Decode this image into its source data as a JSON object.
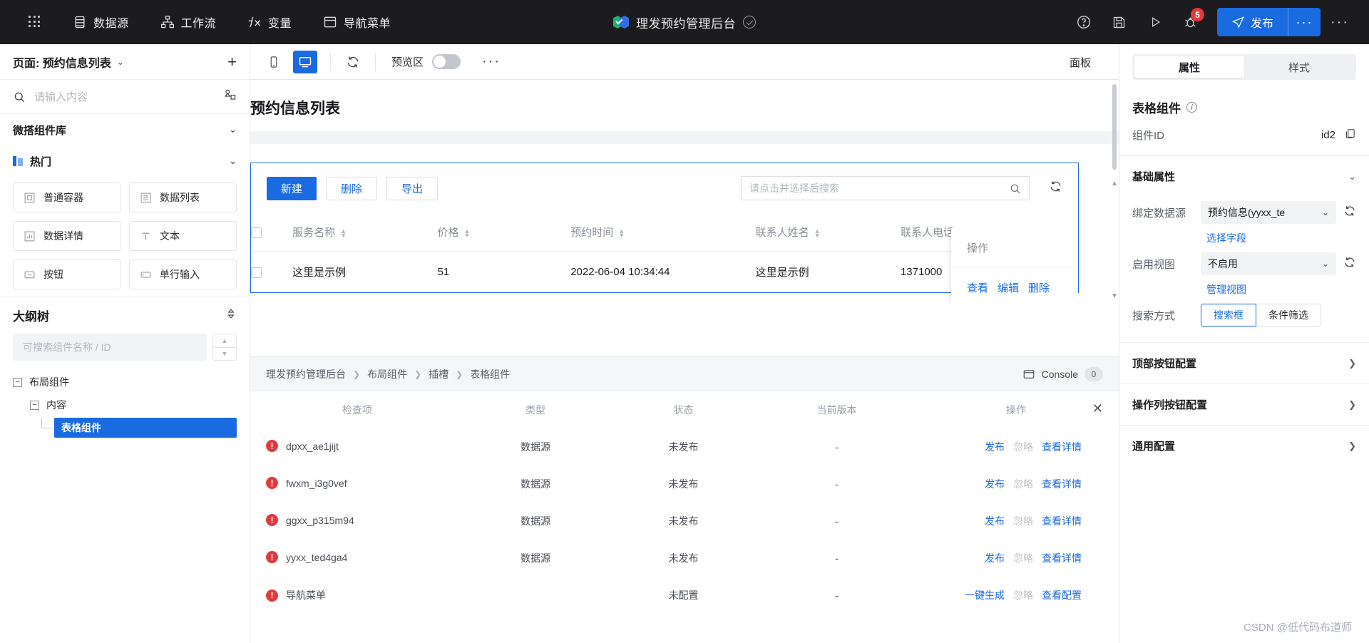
{
  "topbar": {
    "apps_icon": "grid-apps-icon",
    "nav": [
      {
        "label": "数据源",
        "icon": "database-icon"
      },
      {
        "label": "工作流",
        "icon": "workflow-icon"
      },
      {
        "label": "变量",
        "icon": "fx-icon"
      },
      {
        "label": "导航菜单",
        "icon": "window-menu-icon"
      }
    ],
    "app_title": "理发预约管理后台",
    "actions": {
      "help": "help-circle-icon",
      "save": "save-icon",
      "preview": "play-icon",
      "debug": "bug-icon",
      "debug_badge": "5",
      "publish_label": "发布",
      "publish_more": "···",
      "overflow": "···"
    }
  },
  "left": {
    "page_label": "页面: 预约信息列表",
    "add_page": "+",
    "search_placeholder": "请输入内容",
    "library_title": "微搭组件库",
    "group_title": "热门",
    "components": [
      {
        "label": "普通容器",
        "icon": "container-icon"
      },
      {
        "label": "数据列表",
        "icon": "list-icon"
      },
      {
        "label": "数据详情",
        "icon": "detail-chart-icon"
      },
      {
        "label": "文本",
        "icon": "text-icon"
      },
      {
        "label": "按钮",
        "icon": "button-icon"
      },
      {
        "label": "单行输入",
        "icon": "input-icon"
      }
    ],
    "outline_title": "大纲树",
    "outline_search_placeholder": "可搜索组件名称 / ID",
    "tree": [
      {
        "label": "布局组件",
        "level": 0
      },
      {
        "label": "内容",
        "level": 1
      },
      {
        "label": "表格组件",
        "level": 2,
        "selected": true
      }
    ]
  },
  "toolbar": {
    "mobile_icon": "phone-icon",
    "desktop_icon": "desktop-icon",
    "refresh_icon": "refresh-icon",
    "preview_label": "预览区",
    "preview_on": false,
    "more": "···",
    "panel_label": "面板"
  },
  "canvas": {
    "page_title": "预约信息列表",
    "buttons": [
      {
        "label": "新建",
        "type": "primary"
      },
      {
        "label": "删除",
        "type": "default"
      },
      {
        "label": "导出",
        "type": "default"
      }
    ],
    "search_placeholder": "请点击并选择后搜索",
    "search_icon": "search-icon",
    "refresh_icon": "refresh-icon",
    "table": {
      "columns": [
        {
          "label": "服务名称",
          "sortable": true
        },
        {
          "label": "价格",
          "sortable": true
        },
        {
          "label": "预约时间",
          "sortable": true
        },
        {
          "label": "联系人姓名",
          "sortable": true
        },
        {
          "label": "联系人电话",
          "sortable": true
        }
      ],
      "action_column": "操作",
      "rows": [
        {
          "服务名称": "这里是示例",
          "价格": "51",
          "预约时间": "2022-06-04 10:34:44",
          "联系人姓名": "这里是示例",
          "联系人电话": "1371000"
        }
      ],
      "row_actions": [
        "查看",
        "编辑",
        "删除"
      ]
    }
  },
  "console": {
    "breadcrumb": [
      "理发预约管理后台",
      "布局组件",
      "插槽",
      "表格组件"
    ],
    "tab_label": "Console",
    "tab_count": "0",
    "close_icon": "close-icon",
    "columns": [
      "检查项",
      "类型",
      "状态",
      "当前版本",
      "操作"
    ],
    "rows": [
      {
        "name": "dpxx_ae1jijt",
        "type": "数据源",
        "status": "未发布",
        "version": "-",
        "actions": [
          {
            "label": "发布",
            "enabled": true
          },
          {
            "label": "忽略",
            "enabled": false
          },
          {
            "label": "查看详情",
            "enabled": true
          }
        ]
      },
      {
        "name": "fwxm_i3g0vef",
        "type": "数据源",
        "status": "未发布",
        "version": "-",
        "actions": [
          {
            "label": "发布",
            "enabled": true
          },
          {
            "label": "忽略",
            "enabled": false
          },
          {
            "label": "查看详情",
            "enabled": true
          }
        ]
      },
      {
        "name": "ggxx_p315m94",
        "type": "数据源",
        "status": "未发布",
        "version": "-",
        "actions": [
          {
            "label": "发布",
            "enabled": true
          },
          {
            "label": "忽略",
            "enabled": false
          },
          {
            "label": "查看详情",
            "enabled": true
          }
        ]
      },
      {
        "name": "yyxx_ted4ga4",
        "type": "数据源",
        "status": "未发布",
        "version": "-",
        "actions": [
          {
            "label": "发布",
            "enabled": true
          },
          {
            "label": "忽略",
            "enabled": false
          },
          {
            "label": "查看详情",
            "enabled": true
          }
        ]
      },
      {
        "name": "导航菜单",
        "type": "",
        "status": "未配置",
        "version": "-",
        "actions": [
          {
            "label": "一键生成",
            "enabled": true
          },
          {
            "label": "忽略",
            "enabled": false
          },
          {
            "label": "查看配置",
            "enabled": true
          }
        ]
      }
    ],
    "watermark": "CSDN @低代码布道师"
  },
  "right": {
    "tabs": [
      {
        "label": "属性",
        "active": true
      },
      {
        "label": "样式",
        "active": false
      }
    ],
    "component_title": "表格组件",
    "component_id_label": "组件ID",
    "component_id_value": "id2",
    "copy_icon": "copy-icon",
    "base_section": "基础属性",
    "fields": {
      "datasource_label": "绑定数据源",
      "datasource_value": "预约信息(yyxx_te",
      "select_fields_link": "选择字段",
      "view_label": "启用视图",
      "view_value": "不启用",
      "manage_view_link": "管理视图",
      "search_mode_label": "搜索方式",
      "search_mode_options": [
        {
          "label": "搜索框",
          "active": true
        },
        {
          "label": "条件筛选",
          "active": false
        }
      ]
    },
    "sections": [
      "顶部按钮配置",
      "操作列按钮配置",
      "通用配置"
    ]
  },
  "colors": {
    "accent": "#1a6ae0",
    "danger": "#e03a3f",
    "dark": "#1c1c1e"
  }
}
